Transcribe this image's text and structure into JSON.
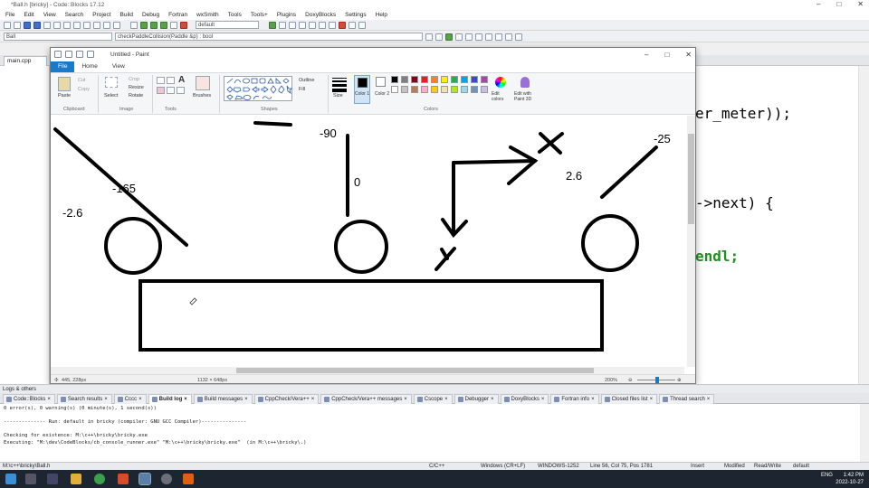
{
  "codeblocks": {
    "window_title": "*Ball.h [bricky] - Code::Blocks 17.12",
    "menu": [
      "File",
      "Edit",
      "View",
      "Search",
      "Project",
      "Build",
      "Debug",
      "Fortran",
      "wxSmith",
      "Tools",
      "Tools+",
      "Plugins",
      "DoxyBlocks",
      "Settings",
      "Help"
    ],
    "scope_combo": "Ball",
    "function_combo": "checkPaddleCollision(Paddle &p) : bool",
    "build_target": "default",
    "file_tab": "main.cpp",
    "code_lines": [
      "er_meter));",
      "->next) {",
      "endl;"
    ],
    "logs_header": "Logs & others",
    "log_tabs": [
      "Code::Blocks",
      "Search results",
      "Cccc",
      "Build log",
      "Build messages",
      "CppCheck/Vera++",
      "CppCheck/Vera++ messages",
      "Cscope",
      "Debugger",
      "DoxyBlocks",
      "Fortran info",
      "Closed files list",
      "Thread search"
    ],
    "active_log_tab": "Build log",
    "log_lines": [
      "0 error(s), 0 warning(s) (0 minute(s), 1 second(s))",
      "",
      "-------------- Run: default in bricky (compiler: GNU GCC Compiler)---------------",
      "",
      "Checking for existence: M:\\c++\\bricky\\bricky.exe",
      "Executing: \"M:\\dev\\CodeBlocks/cb_console_runner.exe\" \"M:\\c++\\bricky\\bricky.exe\"  (in M:\\c++\\bricky\\.)"
    ],
    "status": {
      "path": "M:\\c++\\bricky\\Ball.h",
      "language": "C/C++",
      "line_endings": "Windows (CR+LF)",
      "encoding": "WINDOWS-1252",
      "position": "Line 56, Col 75, Pos 1781",
      "insert": "Insert",
      "modified": "Modified",
      "access": "Read/Write",
      "target": "default"
    }
  },
  "paint": {
    "title": "Untitled - Paint",
    "tabs": [
      "File",
      "Home",
      "View"
    ],
    "ribbon": {
      "clipboard": {
        "paste": "Paste",
        "cut": "Cut",
        "copy": "Copy",
        "group": "Clipboard"
      },
      "image": {
        "select": "Select",
        "crop": "Crop",
        "resize": "Resize",
        "rotate": "Rotate",
        "group": "Image"
      },
      "tools": {
        "group": "Tools",
        "text_tool": "A"
      },
      "brushes": "Brushes",
      "shapes": {
        "group": "Shapes",
        "outline": "Outline",
        "fill": "Fill"
      },
      "size": "Size",
      "color1": "Color 1",
      "color2": "Color 2",
      "edit_colors": "Edit colors",
      "edit_with_paint3d": "Edit with Paint 3D",
      "colors_group": "Colors"
    },
    "palette": [
      "#000000",
      "#7f7f7f",
      "#880015",
      "#ed1c24",
      "#ff7f27",
      "#fff200",
      "#22b14c",
      "#00a2e8",
      "#3f48cc",
      "#a349a4",
      "#ffffff",
      "#c3c3c3",
      "#b97a57",
      "#ffaec9",
      "#ffc90e",
      "#efe4b0",
      "#b5e61d",
      "#99d9ea",
      "#7092be",
      "#c8bfe7"
    ],
    "canvas_labels": {
      "left_value_1": "-2.6",
      "left_value_2": "-165",
      "center_top": "-90",
      "center_bottom": "0",
      "right_value": "-25",
      "arrow_value": "2.6"
    },
    "status": {
      "cursor": "445, 228px",
      "canvas_size": "1132 × 648px",
      "zoom": "200%"
    }
  },
  "taskbar": {
    "time": "1:42 PM",
    "date": "2022-10-27",
    "lang": "ENG"
  }
}
